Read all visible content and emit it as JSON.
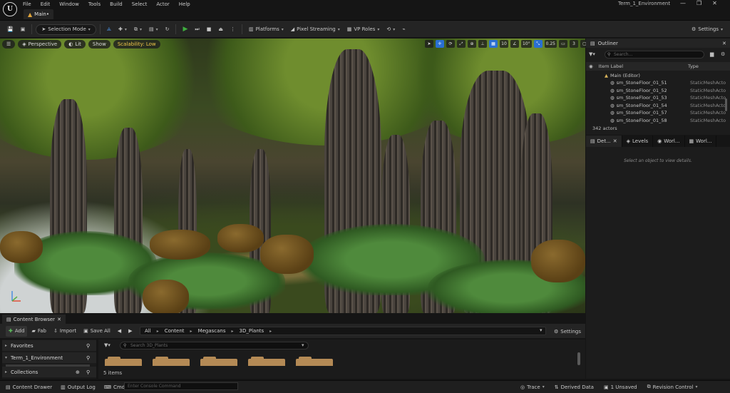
{
  "app": {
    "window_title": "Term_1_Environment",
    "main_tab": "Main•",
    "logo": "unreal-engine-logo"
  },
  "menu": [
    "File",
    "Edit",
    "Window",
    "Tools",
    "Build",
    "Select",
    "Actor",
    "Help"
  ],
  "toolbar": {
    "selection_mode": "Selection Mode",
    "platforms": "Platforms",
    "pixel_streaming": "Pixel Streaming",
    "vp_roles": "VP Roles",
    "settings": "Settings"
  },
  "viewport": {
    "perspective": "Perspective",
    "lit": "Lit",
    "show": "Show",
    "scalability": "Scalability: Low",
    "grid_snap": "10",
    "angle_snap": "10°",
    "scale_snap": "0.25",
    "camera_speed": "3"
  },
  "outliner": {
    "title": "Outliner",
    "search_placeholder": "Search...",
    "col_label": "Item Label",
    "col_type": "Type",
    "root": "Main (Editor)",
    "rows": [
      {
        "label": "sm_StoneFloor_01_51",
        "type": "StaticMeshActo"
      },
      {
        "label": "sm_StoneFloor_01_52",
        "type": "StaticMeshActo"
      },
      {
        "label": "sm_StoneFloor_01_53",
        "type": "StaticMeshActo"
      },
      {
        "label": "sm_StoneFloor_01_54",
        "type": "StaticMeshActo"
      },
      {
        "label": "sm_StoneFloor_01_57",
        "type": "StaticMeshActo"
      },
      {
        "label": "sm_StoneFloor_01_58",
        "type": "StaticMeshActo"
      }
    ],
    "actor_count": "342 actors"
  },
  "details": {
    "tab_details": "Det...",
    "tab_levels": "Levels",
    "tab_world1": "Worl...",
    "tab_world2": "Worl...",
    "empty_message": "Select an object to view details."
  },
  "content_browser": {
    "tab": "Content Browser",
    "add": "Add",
    "fab": "Fab",
    "import": "Import",
    "save_all": "Save All",
    "settings": "Settings",
    "path": [
      "All",
      "Content",
      "Megascans",
      "3D_Plants"
    ],
    "search_placeholder": "Search 3D_Plants",
    "favorites": "Favorites",
    "project": "Term_1_Environment",
    "collections": "Collections",
    "item_count": "5 items"
  },
  "status": {
    "content_drawer": "Content Drawer",
    "output_log": "Output Log",
    "cmd": "Cmd",
    "console_placeholder": "Enter Console Command",
    "trace": "Trace",
    "derived_data": "Derived Data",
    "unsaved": "1 Unsaved",
    "revision_control": "Revision Control"
  },
  "colors": {
    "accent_blue": "#2a6fd2",
    "play_green": "#3fae3f",
    "scalability_yellow": "#f0c64a"
  }
}
